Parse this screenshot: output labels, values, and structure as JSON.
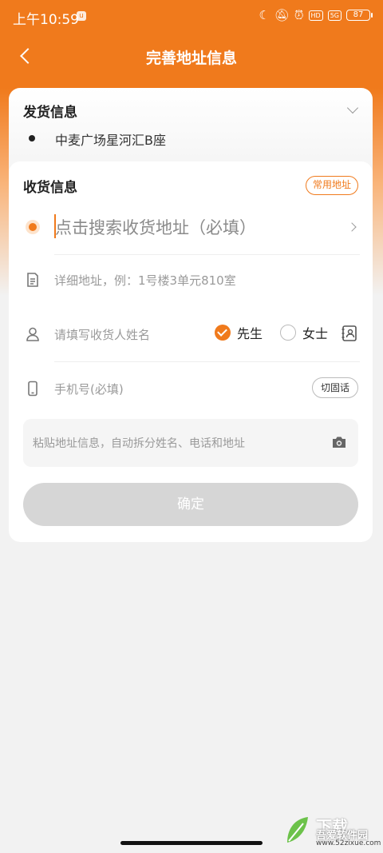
{
  "status_bar": {
    "time": "上午10:59",
    "signal": "5G",
    "battery": "87"
  },
  "nav": {
    "title": "完善地址信息"
  },
  "shipping": {
    "title": "发货信息",
    "address": "中麦广场星河汇B座"
  },
  "receiving": {
    "title": "收货信息",
    "common_address_label": "常用地址",
    "search_placeholder": "点击搜索收货地址（必填）",
    "detail_placeholder": "详细地址，例：1号楼3单元810室",
    "name_placeholder": "请填写收货人姓名",
    "gender_options": [
      "先生",
      "女士"
    ],
    "gender_selected": "先生",
    "phone_placeholder": "手机号(必填)",
    "landline_label": "切固话",
    "paste_placeholder": "粘贴地址信息，自动拆分姓名、电话和地址",
    "confirm_label": "确定"
  },
  "watermark": {
    "main": "下载",
    "name": "吾爱软件园",
    "url": "www.52zixue.com"
  },
  "colors": {
    "accent": "#f07a1c",
    "disabled_button": "#d6d6d6"
  },
  "icons": [
    "back-arrow-icon",
    "chevron-down-icon",
    "chevron-right-icon",
    "document-icon",
    "person-icon",
    "contact-book-icon",
    "phone-icon",
    "camera-icon"
  ]
}
